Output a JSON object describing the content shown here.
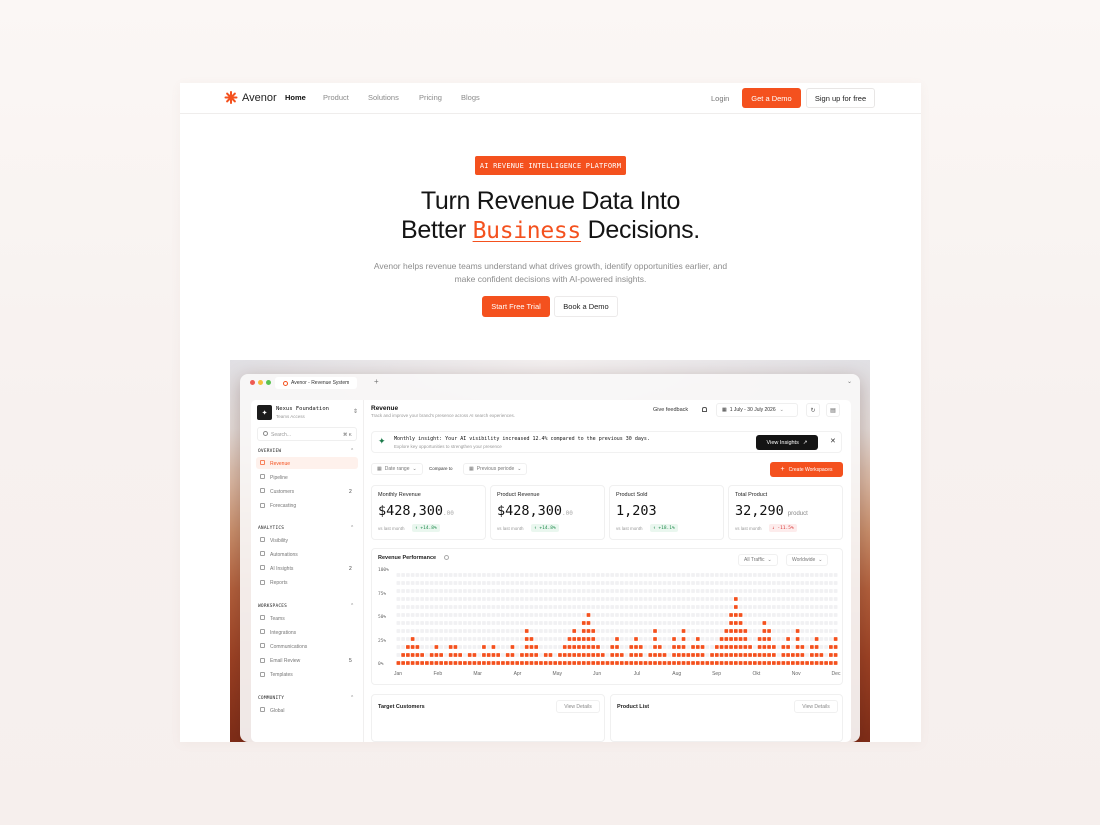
{
  "nav": {
    "brand": "Avenor",
    "links": [
      "Home",
      "Product",
      "Solutions",
      "Pricing",
      "Blogs"
    ],
    "login": "Login",
    "demo": "Get a Demo",
    "signup": "Sign up for free"
  },
  "hero": {
    "badge": "AI REVENUE INTELLIGENCE PLATFORM",
    "title_line1": "Turn Revenue Data Into",
    "title_line2_pre": "Better ",
    "title_line2_highlight": "Business",
    "title_line2_post": " Decisions.",
    "subtitle": "Avenor helps revenue teams understand what drives growth, identify opportunities earlier, and make confident decisions with AI-powered insights.",
    "cta_primary": "Start Free Trial",
    "cta_secondary": "Book a Demo"
  },
  "app": {
    "tab_title": "Avenor - Revenue System",
    "org_name": "Nexus Foundation",
    "org_sub": "Teams Access",
    "search_placeholder": "Search...",
    "search_shortcut": "⌘ K",
    "sections": [
      {
        "title": "OVERVIEW",
        "items": [
          {
            "label": "Revenue",
            "count": "",
            "active": true
          },
          {
            "label": "Pipeline",
            "count": ""
          },
          {
            "label": "Customers",
            "count": "2"
          },
          {
            "label": "Forecasting",
            "count": ""
          }
        ]
      },
      {
        "title": "ANALYTICS",
        "items": [
          {
            "label": "Visibility",
            "count": ""
          },
          {
            "label": "Automations",
            "count": ""
          },
          {
            "label": "AI Insights",
            "count": "2"
          },
          {
            "label": "Reports",
            "count": ""
          }
        ]
      },
      {
        "title": "WORKSPACES",
        "items": [
          {
            "label": "Teams",
            "count": ""
          },
          {
            "label": "Integrations",
            "count": ""
          },
          {
            "label": "Communications",
            "count": ""
          },
          {
            "label": "Email Review",
            "count": "5"
          },
          {
            "label": "Templates",
            "count": ""
          }
        ]
      },
      {
        "title": "COMMUNITY",
        "items": [
          {
            "label": "Global",
            "count": ""
          }
        ]
      }
    ],
    "header_title": "Revenue",
    "header_sub": "Track and improve your brand's presence across AI search experiences.",
    "feedback": "Give feedback",
    "date_range": "1 July - 30 July 2026",
    "insight_title": "Monthly insight: Your AI visibility increased 12.4% compared to the previous 30 days.",
    "insight_sub": "Explore key opportunities to strengthen your presence",
    "insight_btn": "View Insights",
    "filter_date": "Date range",
    "compare_label": "Compare to",
    "filter_compare": "Previous periode",
    "create_btn": "Create Workspaces",
    "kpis": [
      {
        "title": "Monthly Revenue",
        "value": "$428,300",
        "decimals": ".00",
        "unit": "",
        "vs": "vs last month",
        "delta": "+14.8%",
        "dir": "up"
      },
      {
        "title": "Product Revenue",
        "value": "$428,300",
        "decimals": ".00",
        "unit": "",
        "vs": "vs last month",
        "delta": "+14.8%",
        "dir": "up"
      },
      {
        "title": "Product Sold",
        "value": "1,203",
        "decimals": "",
        "unit": "",
        "vs": "vs last month",
        "delta": "+18.1%",
        "dir": "up"
      },
      {
        "title": "Total Product",
        "value": "32,290",
        "decimals": "",
        "unit": "product",
        "vs": "vs last month",
        "delta": "-11.5%",
        "dir": "down"
      }
    ],
    "perf_title": "Revenue Performance",
    "traffic_filter": "All Traffic",
    "region_filter": "Worldwide",
    "target_title": "Target Customers",
    "product_title": "Product List",
    "view_details": "View Details"
  },
  "chart_data": {
    "type": "bar",
    "title": "Revenue Performance",
    "y_ticks": [
      "100%",
      "75%",
      "50%",
      "25%",
      "0%"
    ],
    "ylim": [
      0,
      100
    ],
    "x_labels": [
      "Jan",
      "Feb",
      "Mar",
      "Apr",
      "May",
      "Jun",
      "Jul",
      "Aug",
      "Sep",
      "Okt",
      "Nov",
      "Dec"
    ],
    "values": [
      8,
      17,
      25,
      33,
      25,
      17,
      8,
      17,
      25,
      17,
      8,
      25,
      25,
      17,
      8,
      17,
      17,
      8,
      25,
      17,
      25,
      17,
      8,
      17,
      25,
      8,
      17,
      42,
      33,
      25,
      8,
      17,
      17,
      8,
      17,
      25,
      33,
      42,
      33,
      50,
      58,
      42,
      25,
      17,
      8,
      25,
      33,
      17,
      8,
      25,
      33,
      25,
      8,
      17,
      42,
      25,
      17,
      8,
      33,
      25,
      42,
      17,
      25,
      33,
      25,
      8,
      17,
      25,
      33,
      42,
      58,
      75,
      58,
      42,
      25,
      17,
      33,
      50,
      42,
      25,
      8,
      25,
      33,
      17,
      42,
      25,
      8,
      25,
      33,
      17,
      8,
      25,
      33
    ]
  },
  "colors": {
    "accent": "#f4511e",
    "empty_cell": "#f1f1f3"
  }
}
